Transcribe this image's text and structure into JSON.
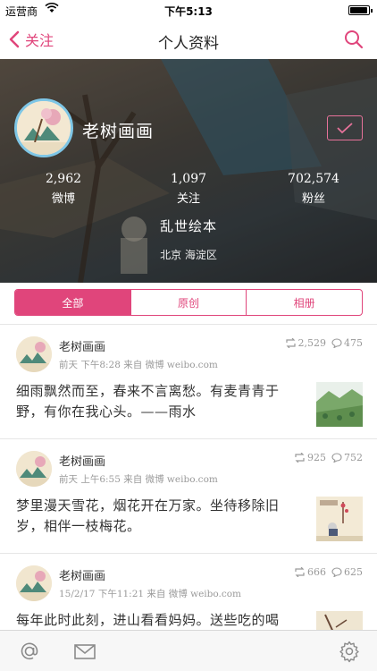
{
  "status_bar": {
    "carrier": "运营商",
    "time": "下午5:13",
    "battery_level": 0.95
  },
  "nav": {
    "back_label": "关注",
    "title": "个人资料"
  },
  "profile": {
    "name": "老树画画",
    "stats": [
      {
        "value": "2,962",
        "label": "微博"
      },
      {
        "value": "1,097",
        "label": "关注"
      },
      {
        "value": "702,574",
        "label": "粉丝"
      }
    ],
    "bio": "乱世绘本",
    "location": "北京 海淀区"
  },
  "segments": [
    {
      "label": "全部",
      "active": true
    },
    {
      "label": "原创",
      "active": false
    },
    {
      "label": "相册",
      "active": false
    }
  ],
  "posts": [
    {
      "author": "老树画画",
      "meta": "前天 下午8:28 来自 微博 weibo.com",
      "reposts": "2,529",
      "comments": "475",
      "content": "细雨飘然而至，春来不言离愁。有麦青青于野，有你在我心头。——雨水"
    },
    {
      "author": "老树画画",
      "meta": "前天 上午6:55 来自 微博 weibo.com",
      "reposts": "925",
      "comments": "752",
      "content": "梦里漫天雪花，烟花开在万家。坐待移除旧岁，相伴一枝梅花。"
    },
    {
      "author": "老树画画",
      "meta": "15/2/17 下午11:21 来自 微博 weibo.com",
      "reposts": "666",
      "comments": "625",
      "content": "每年此时此刻，进山看看妈妈。送些吃的喝"
    }
  ],
  "colors": {
    "accent": "#e0457b",
    "avatar_ring": "#7ec6e6"
  },
  "icons": {
    "back": "chevron-left-icon",
    "search": "search-icon",
    "follow": "checkmark-icon",
    "repost": "repost-icon",
    "comment": "comment-icon",
    "mention": "at-icon",
    "messages": "envelope-icon",
    "settings": "gear-icon"
  }
}
